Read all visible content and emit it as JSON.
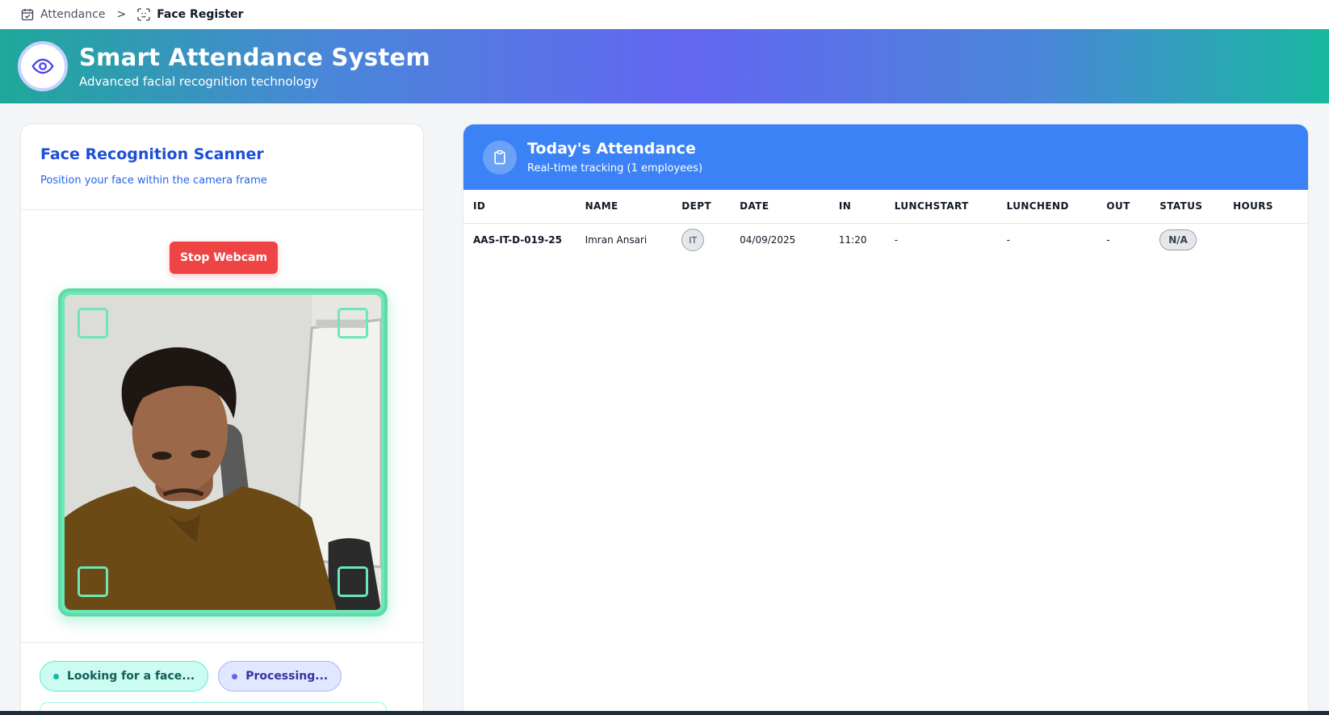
{
  "breadcrumb": {
    "parent": "Attendance",
    "separator": ">",
    "current": "Face Register"
  },
  "banner": {
    "title": "Smart Attendance System",
    "subtitle": "Advanced facial recognition technology",
    "icon": "eye-icon"
  },
  "scanner": {
    "title": "Face Recognition Scanner",
    "subtitle": "Position your face within the camera frame",
    "stop_button": "Stop Webcam",
    "status_looking": "Looking for a face...",
    "status_processing": "Processing..."
  },
  "attendance": {
    "title": "Today's Attendance",
    "subtitle": "Real-time tracking (1 employees)",
    "icon": "clipboard-icon",
    "columns": [
      "ID",
      "NAME",
      "DEPT",
      "DATE",
      "IN",
      "LUNCHSTART",
      "LUNCHEND",
      "OUT",
      "STATUS",
      "HOURS"
    ],
    "rows": [
      {
        "id": "AAS-IT-D-019-25",
        "name": "Imran Ansari",
        "dept": "IT",
        "date": "04/09/2025",
        "in": "11:20",
        "lunchstart": "-",
        "lunchend": "-",
        "out": "-",
        "status": "N/A",
        "hours": ""
      }
    ]
  },
  "colors": {
    "accent_blue": "#3b82f6",
    "stop_red": "#ef4444",
    "scanner_green": "#6ee7b7"
  }
}
